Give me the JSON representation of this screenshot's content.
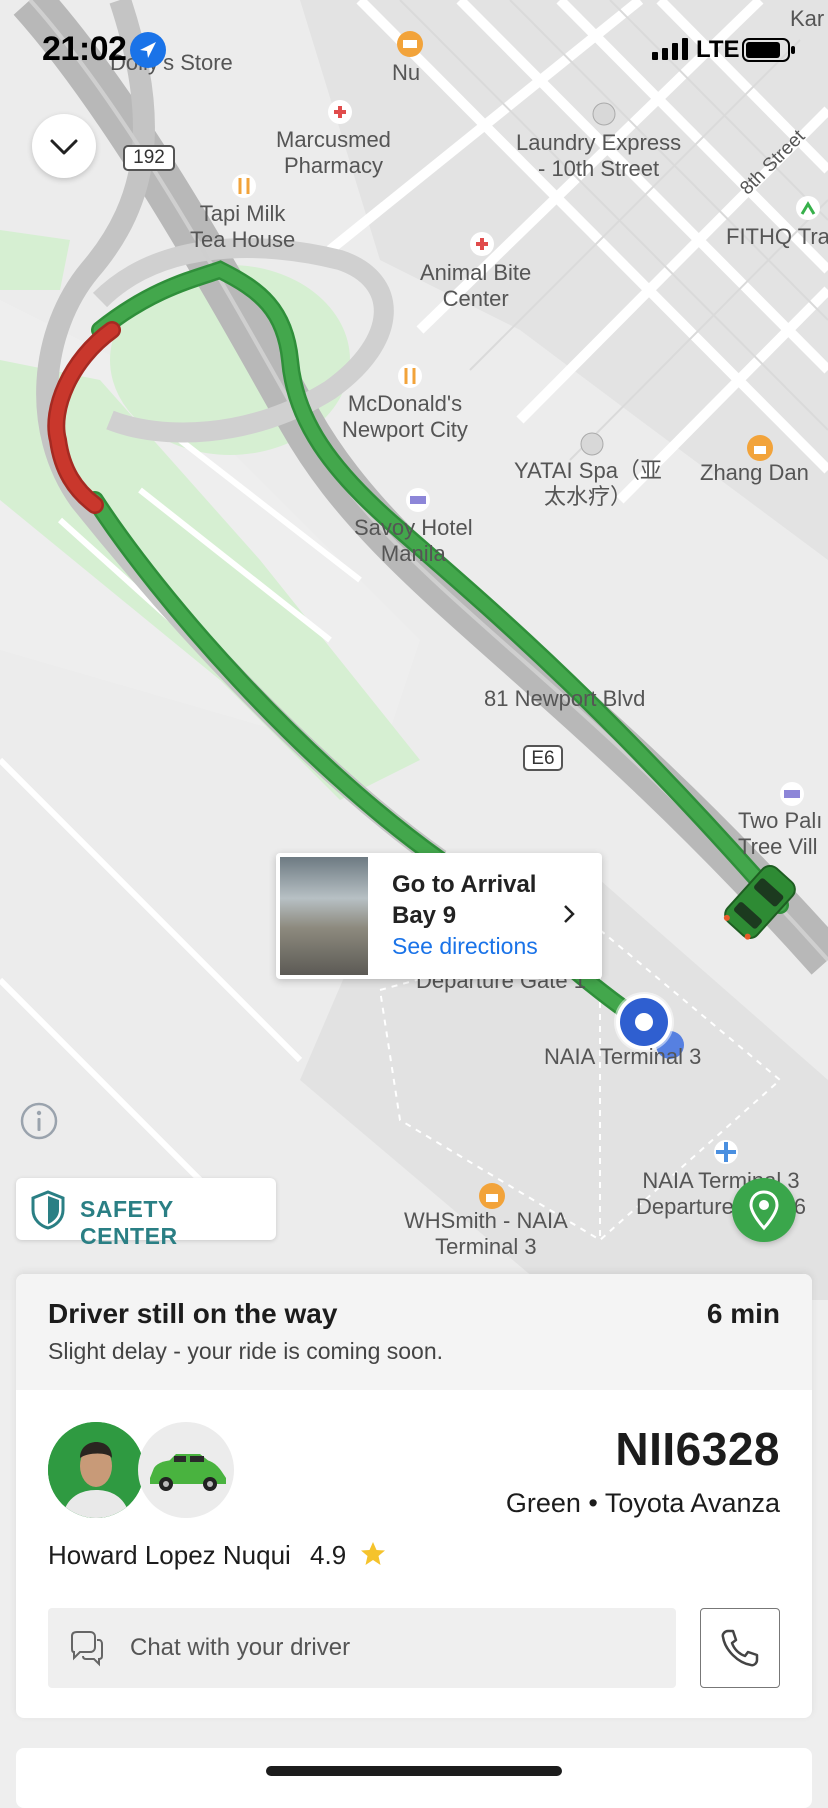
{
  "status_bar": {
    "time": "21:02",
    "network": "LTE"
  },
  "map": {
    "labels": {
      "dollys": "Dolly's Store",
      "nu": "Nu",
      "kar": "Kar",
      "marcusmed": "Marcusmed\nPharmacy",
      "laundry": "Laundry Express\n- 10th Street",
      "street8": "8th Street",
      "fithq": "FITHQ Tra",
      "route192": "192",
      "tapi": "Tapi Milk\nTea House",
      "animal": "Animal Bite\nCenter",
      "mcd": "McDonald's\nNewport City",
      "yatai": "YATAI Spa（亚\n太水疗）",
      "zhang": "Zhang Dan",
      "savoy": "Savoy Hotel\nManila",
      "newport": "81 Newport Blvd",
      "e6": "E6",
      "twopalm": "Two Palı\nTree Vill",
      "depgate": "Departure Gate 1",
      "naia3": "NAIA Terminal 3",
      "naia3dep": "NAIA Terminal 3\nDeparture Gate 6",
      "whsmith": "WHSmith - NAIA\nTerminal 3"
    },
    "callout": {
      "title": "Go to Arrival Bay 9",
      "link": "See directions"
    },
    "safety_center": "SAFETY CENTER"
  },
  "trip": {
    "status_title": "Driver still on the way",
    "status_sub": "Slight delay - your ride is coming soon.",
    "eta": "6 min",
    "plate": "NII6328",
    "vehicle": "Green • Toyota Avanza",
    "driver_name": "Howard Lopez Nuqui",
    "rating": "4.9",
    "chat_placeholder": "Chat with your driver"
  },
  "colors": {
    "route_green": "#43a74c",
    "route_red": "#c9372c",
    "accent_blue": "#1a73e8",
    "safety_teal": "#2a7f84"
  }
}
